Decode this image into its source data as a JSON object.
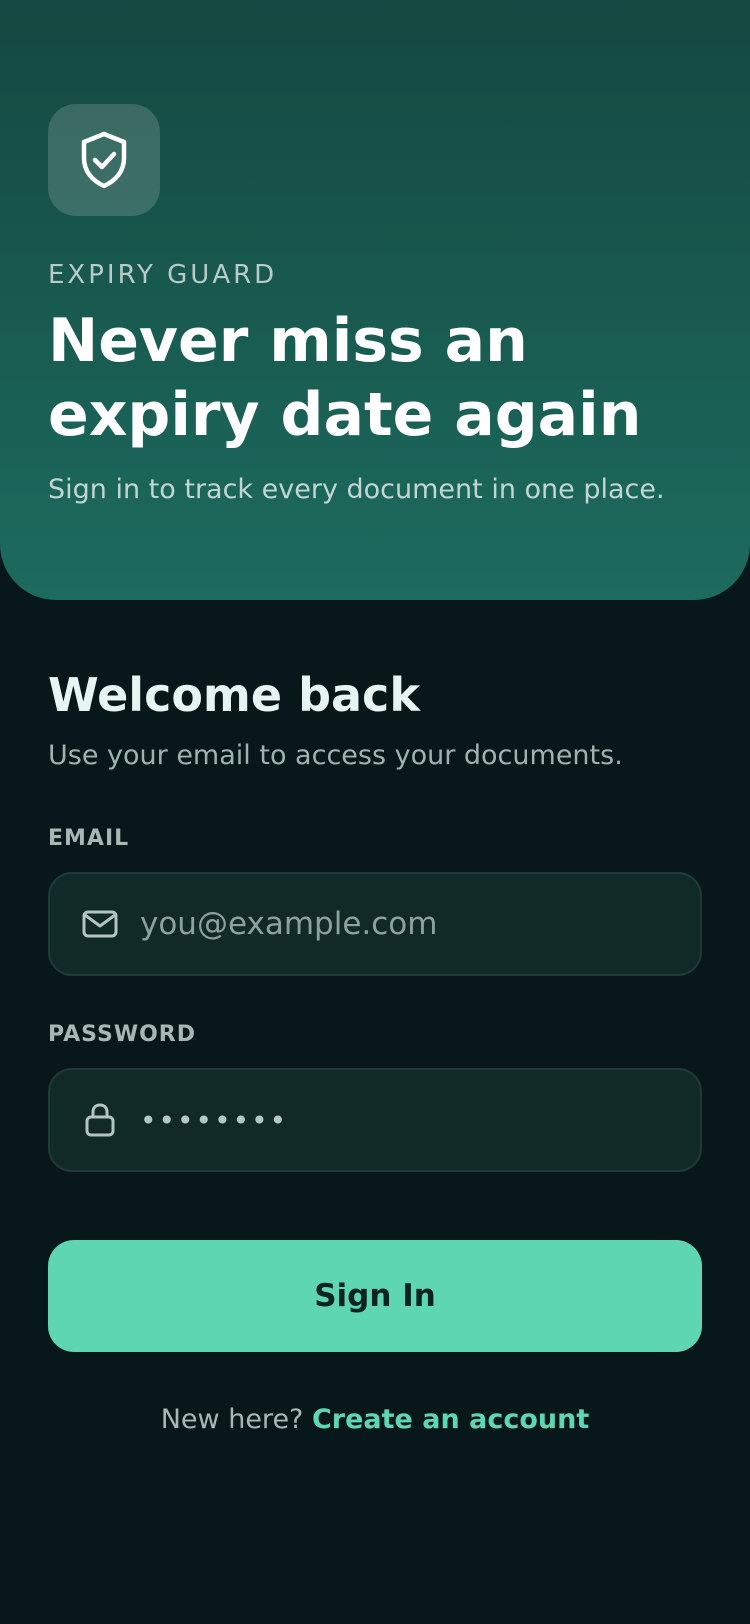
{
  "brand": {
    "eyebrow": "EXPIRY GUARD",
    "logo_icon": "shield-check-icon"
  },
  "hero": {
    "title": "Never miss an expiry date again",
    "subtitle": "Sign in to track every document in one place."
  },
  "login": {
    "heading": "Welcome back",
    "subheading": "Use your email to access your documents.",
    "email": {
      "label": "EMAIL",
      "placeholder": "you@example.com",
      "value": "",
      "icon": "mail-icon"
    },
    "password": {
      "label": "PASSWORD",
      "masked_value": "••••••••",
      "icon": "lock-icon"
    },
    "submit_label": "Sign In"
  },
  "footer": {
    "prompt": "New here?",
    "link_label": "Create an account"
  },
  "colors": {
    "hero_top": "#144841",
    "hero_bottom": "#1d6b5e",
    "background": "#08181a",
    "accent": "#5dd6b1",
    "field_bg": "#112a27"
  }
}
